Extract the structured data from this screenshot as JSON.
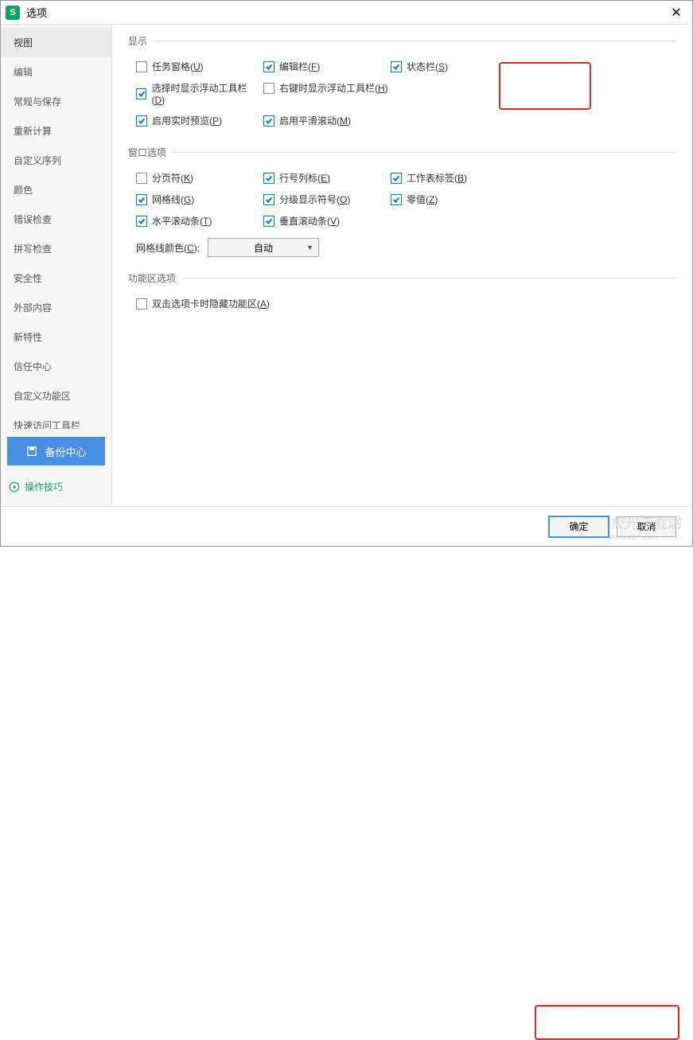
{
  "window": {
    "title": "选项"
  },
  "sidebar": {
    "items": [
      {
        "label": "视图",
        "active": true
      },
      {
        "label": "编辑"
      },
      {
        "label": "常规与保存"
      },
      {
        "label": "重新计算"
      },
      {
        "label": "自定义序列"
      },
      {
        "label": "颜色"
      },
      {
        "label": "错误检查"
      },
      {
        "label": "拼写检查"
      },
      {
        "label": "安全性"
      },
      {
        "label": "外部内容"
      },
      {
        "label": "新特性"
      },
      {
        "label": "信任中心"
      },
      {
        "label": "自定义功能区"
      },
      {
        "label": "快速访问工具栏"
      }
    ],
    "backup": "备份中心",
    "tips": "操作技巧"
  },
  "sections": {
    "display": {
      "legend": "显示",
      "items": {
        "task_pane": {
          "label": "任务窗格(",
          "accel": "U",
          "suffix": ")",
          "checked": false
        },
        "formula_bar": {
          "label": "编辑栏(",
          "accel": "F",
          "suffix": ")",
          "checked": true
        },
        "status_bar": {
          "label": "状态栏(",
          "accel": "S",
          "suffix": ")",
          "checked": true
        },
        "select_float": {
          "label": "选择时显示浮动工具栏(",
          "accel": "D",
          "suffix": ")",
          "checked": true
        },
        "rclick_float": {
          "label": "右键时显示浮动工具栏(",
          "accel": "H",
          "suffix": ")",
          "checked": false
        },
        "live_preview": {
          "label": "启用实时预览(",
          "accel": "P",
          "suffix": ")",
          "checked": true
        },
        "smooth_scroll": {
          "label": "启用平滑滚动(",
          "accel": "M",
          "suffix": ")",
          "checked": true
        }
      }
    },
    "windowopt": {
      "legend": "窗口选项",
      "items": {
        "page_break": {
          "label": "分页符(",
          "accel": "K",
          "suffix": ")",
          "checked": false
        },
        "rowcol_hdr": {
          "label": "行号列标(",
          "accel": "E",
          "suffix": ")",
          "checked": true
        },
        "sheet_tab": {
          "label": "工作表标签(",
          "accel": "B",
          "suffix": ")",
          "checked": true
        },
        "gridlines": {
          "label": "网格线(",
          "accel": "G",
          "suffix": ")",
          "checked": true
        },
        "outline_sym": {
          "label": "分级显示符号(",
          "accel": "O",
          "suffix": ")",
          "checked": true
        },
        "zero_val": {
          "label": "零值(",
          "accel": "Z",
          "suffix": ")",
          "checked": true
        },
        "hscroll": {
          "label": "水平滚动条(",
          "accel": "T",
          "suffix": ")",
          "checked": true
        },
        "vscroll": {
          "label": "垂直滚动条(",
          "accel": "V",
          "suffix": ")",
          "checked": true
        }
      },
      "gridcolor_label": "网格线颜色(",
      "gridcolor_accel": "C",
      "gridcolor_suffix": "):",
      "gridcolor_value": "自动"
    },
    "ribbon": {
      "legend": "功能区选项",
      "dblclick_hide": {
        "label": "双击选项卡时隐藏功能区(",
        "accel": "A",
        "suffix": ")",
        "checked": false
      }
    }
  },
  "footer": {
    "ok": "确定",
    "cancel": "取消"
  },
  "watermark": {
    "main": "极光下载站",
    "sub": "www.xz7.com"
  }
}
